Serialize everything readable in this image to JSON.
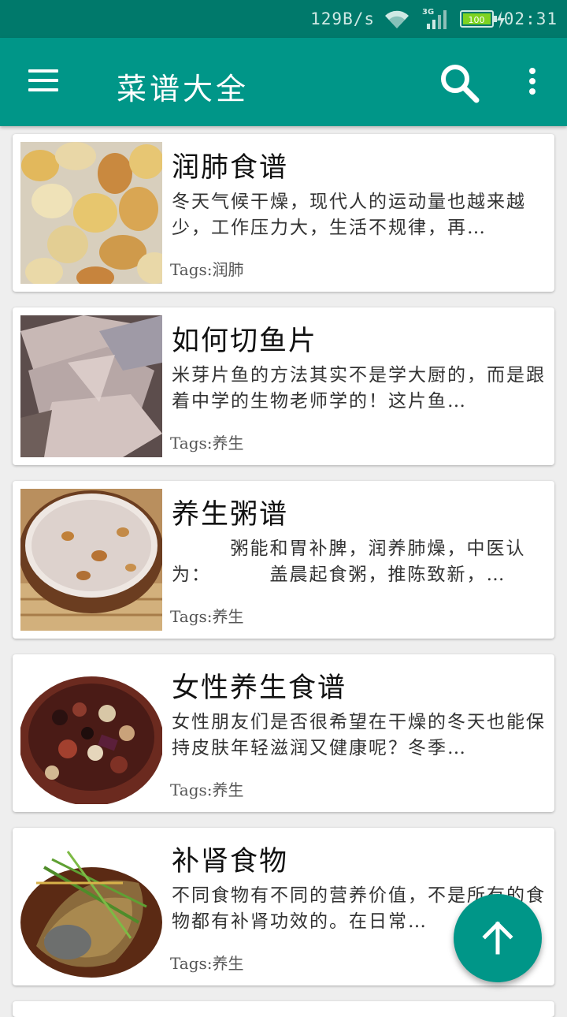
{
  "status_bar": {
    "net_speed": "129B/s",
    "network": "3G",
    "battery": "100",
    "time": "02:31"
  },
  "app_bar": {
    "title": "菜谱大全",
    "menu_icon": "hamburger-menu-icon",
    "search_icon": "search-icon",
    "more_icon": "more-vert-icon"
  },
  "recipes": [
    {
      "title": "润肺食谱",
      "desc": "冬天气候干燥，现代人的运动量也越来越少，工作压力大，生活不规律，再…",
      "tags": "Tags:润肺",
      "image": "ginkgo-nuts-photo"
    },
    {
      "title": "如何切鱼片",
      "desc": "米芽片鱼的方法其实不是学大厨的，而是跟着中学的生物老师学的！这片鱼…",
      "tags": "Tags:养生",
      "image": "sliced-fish-photo"
    },
    {
      "title": "养生粥谱",
      "desc": "        粥能和胃补脾，润养肺燥，中医认为：        盖晨起食粥，推陈致新，…",
      "tags": "Tags:养生",
      "image": "congee-bowl-photo"
    },
    {
      "title": "女性养生食谱",
      "desc": "女性朋友们是否很希望在干燥的冬天也能保持皮肤年轻滋润又健康呢？冬季…",
      "tags": "Tags:养生",
      "image": "bean-stew-photo"
    },
    {
      "title": "补肾食物",
      "desc": "不同食物有不同的营养价值，不是所有的食物都有补肾功效的。在日常…",
      "tags": "Tags:养生",
      "image": "braised-fish-photo"
    }
  ],
  "fab": {
    "icon": "arrow-up-icon"
  }
}
